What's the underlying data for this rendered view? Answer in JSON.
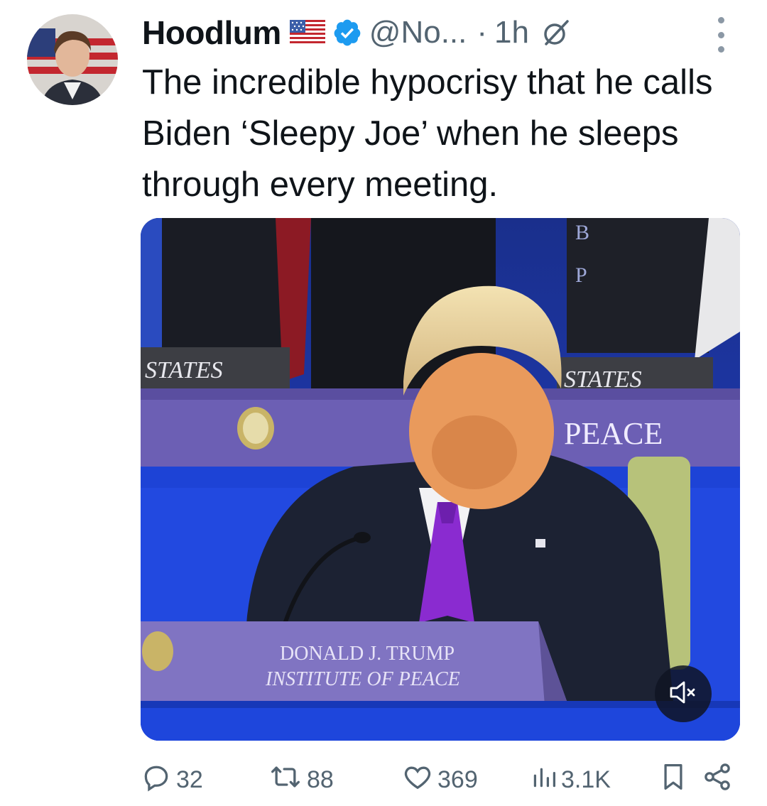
{
  "tweet": {
    "author_name": "Hoodlum",
    "handle": "@No...",
    "separator": "·",
    "time": "1h",
    "text": "The incredible hypocrisy that he calls Biden ‘Sleepy Joe’ when he sleeps through every meeting."
  },
  "media": {
    "sign_left": "STATES",
    "sign_right": "STATES",
    "banner_right": "PEACE",
    "nameplate_line1": "DONALD J. TRUMP",
    "nameplate_line2": "INSTITUTE OF PEACE",
    "banner_top": "B",
    "banner_top2": "P"
  },
  "actions": {
    "replies": "32",
    "reposts": "88",
    "likes": "369",
    "views": "3.1K"
  },
  "icons": {
    "verified": "verified-badge-icon",
    "flag": "us-flag-icon",
    "grok": "grok-icon",
    "more": "more-dots-icon",
    "reply": "reply-icon",
    "repost": "repost-icon",
    "like": "heart-icon",
    "views": "views-icon",
    "bookmark": "bookmark-icon",
    "share": "share-icon",
    "mute": "muted-speaker-icon"
  },
  "colors": {
    "verified": "#1d9bf0",
    "secondary_text": "#536471",
    "stage_blue": "#1d43d6",
    "tie_purple": "#8a2bd0"
  }
}
